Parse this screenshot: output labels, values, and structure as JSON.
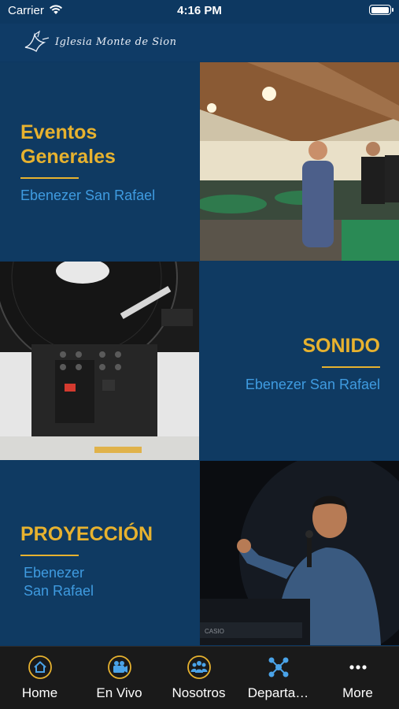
{
  "status_bar": {
    "carrier": "Carrier",
    "time": "4:16 PM",
    "battery_level": 1.0
  },
  "header": {
    "logo_text": "Iglesia Monte de Sion"
  },
  "categories": [
    {
      "title": "Eventos\nGenerales",
      "subtitle": "Ebenezer San Rafael",
      "image": "event-photo"
    },
    {
      "title": "SONIDO",
      "subtitle": "Ebenezer San Rafael",
      "image": "mixer-photo"
    },
    {
      "title": "PROYECCIÓN",
      "subtitle": "Ebenezer\nSan Rafael",
      "image": "preacher-photo"
    }
  ],
  "tabbar": {
    "tabs": [
      {
        "label": "Home",
        "icon": "home-icon"
      },
      {
        "label": "En Vivo",
        "icon": "video-camera-icon"
      },
      {
        "label": "Nosotros",
        "icon": "group-icon"
      },
      {
        "label": "Departa…",
        "icon": "network-icon"
      },
      {
        "label": "More",
        "icon": "more-dots-icon"
      }
    ]
  },
  "colors": {
    "accent_gold": "#e7b22f",
    "accent_blue": "#3f9be0",
    "panel_blue": "#0f3a62",
    "icon_blue": "#4aa3e8",
    "icon_ring": "#e7b22f"
  }
}
